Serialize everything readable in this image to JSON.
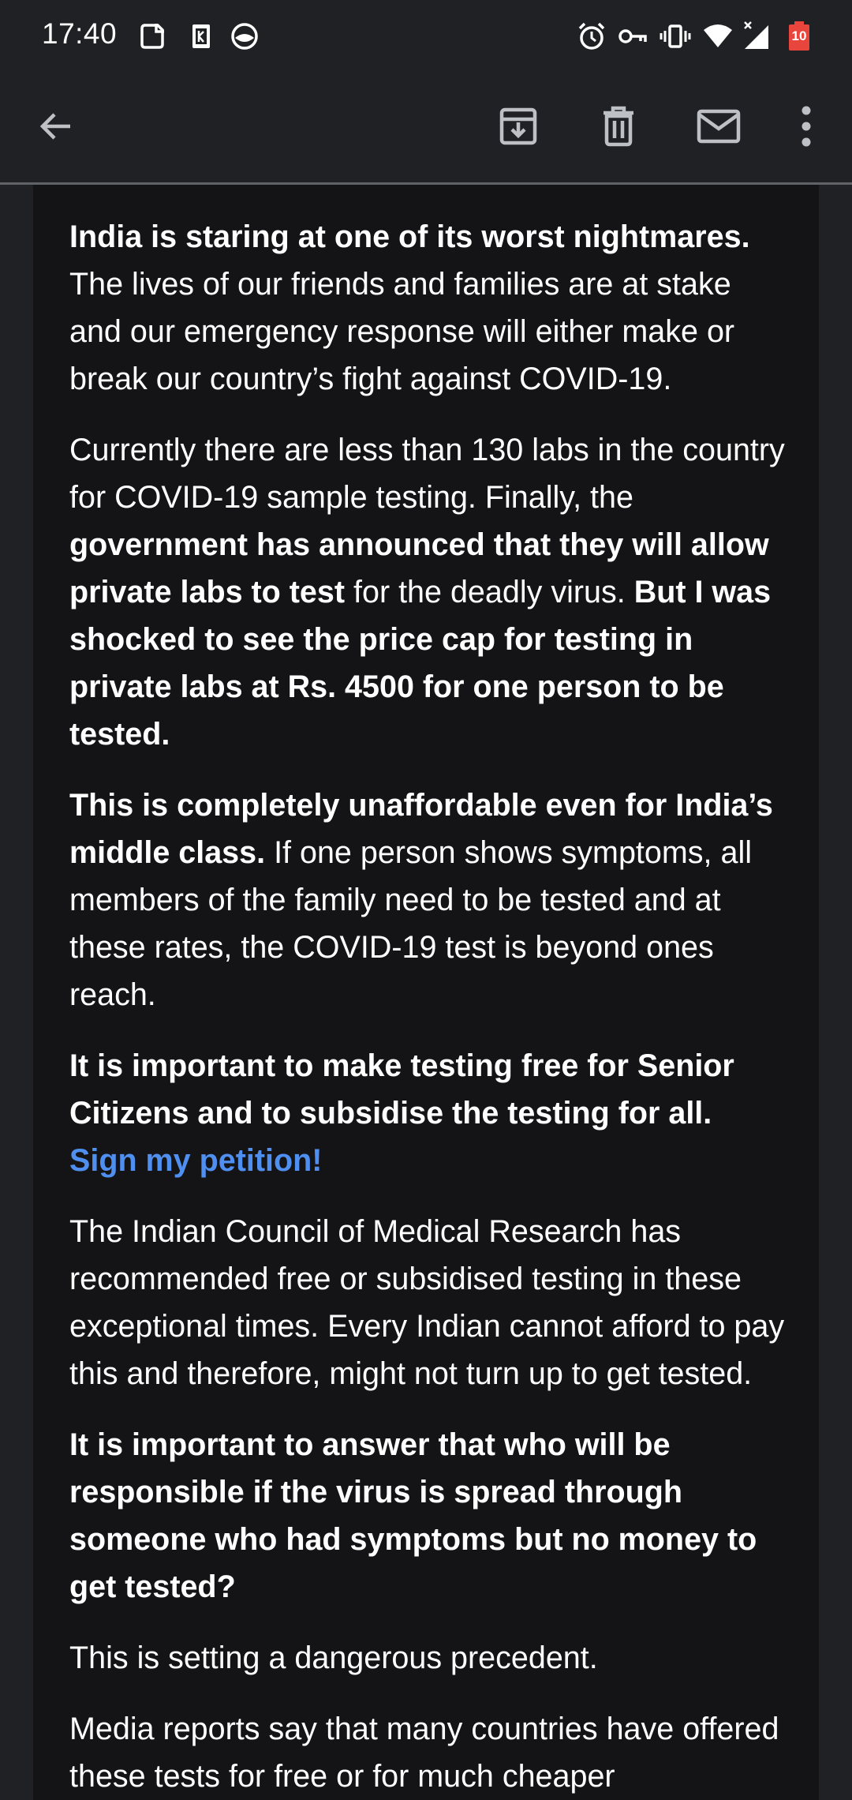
{
  "status_bar": {
    "time": "17:40",
    "battery_level": "10",
    "icons": [
      "screenshot-icon",
      "sim-card-icon",
      "vpn-shield-icon",
      "alarm-icon",
      "vpn-key-icon",
      "vibrate-icon",
      "wifi-icon",
      "cell-signal-icon",
      "battery-icon"
    ]
  },
  "app_bar": {
    "icons": [
      "back-arrow-icon",
      "archive-icon",
      "delete-icon",
      "mark-unread-icon",
      "more-vert-icon"
    ]
  },
  "email": {
    "p1_bold": "India is staring at one of its worst nightmares.",
    "p1_rest": " The lives of our friends and families are at stake and our emergency response will either make or break our country’s fight against COVID-19.",
    "p2_a": "Currently there are less than 130 labs in the country for COVID-19 sample testing. Finally, the ",
    "p2_b_bold": "government has announced that they will allow private labs to test",
    "p2_c": " for the deadly virus. ",
    "p2_d_bold": "But I was shocked to see the price cap for testing in private labs at Rs. 4500 for one person to be tested.",
    "p3_bold": "This is completely unaffordable even for India’s middle class.",
    "p3_rest": " If one person shows symptoms, all members of the family need to be tested and at these rates, the COVID-19 test is beyond ones reach.",
    "p4_bold": "It is important to make testing free for Senior Citizens and to subsidise the testing for all.",
    "p4_link": "Sign my petition!",
    "p5": "The Indian Council of Medical Research has recommended free or subsidised testing in these exceptional times. Every Indian cannot afford to pay this and therefore, might not turn up to get tested.",
    "p6_bold": "It is important to answer that who will be responsible if the virus is spread through someone who had symptoms but no money to get tested?",
    "p7": "This is setting a dangerous precedent.",
    "p8": "Media reports say that many countries have offered these tests for free or for much cheaper"
  },
  "colors": {
    "background": "#202124",
    "card": "#141416",
    "text": "#ffffff",
    "link": "#4f8ff0",
    "battery": "#e8453c"
  }
}
